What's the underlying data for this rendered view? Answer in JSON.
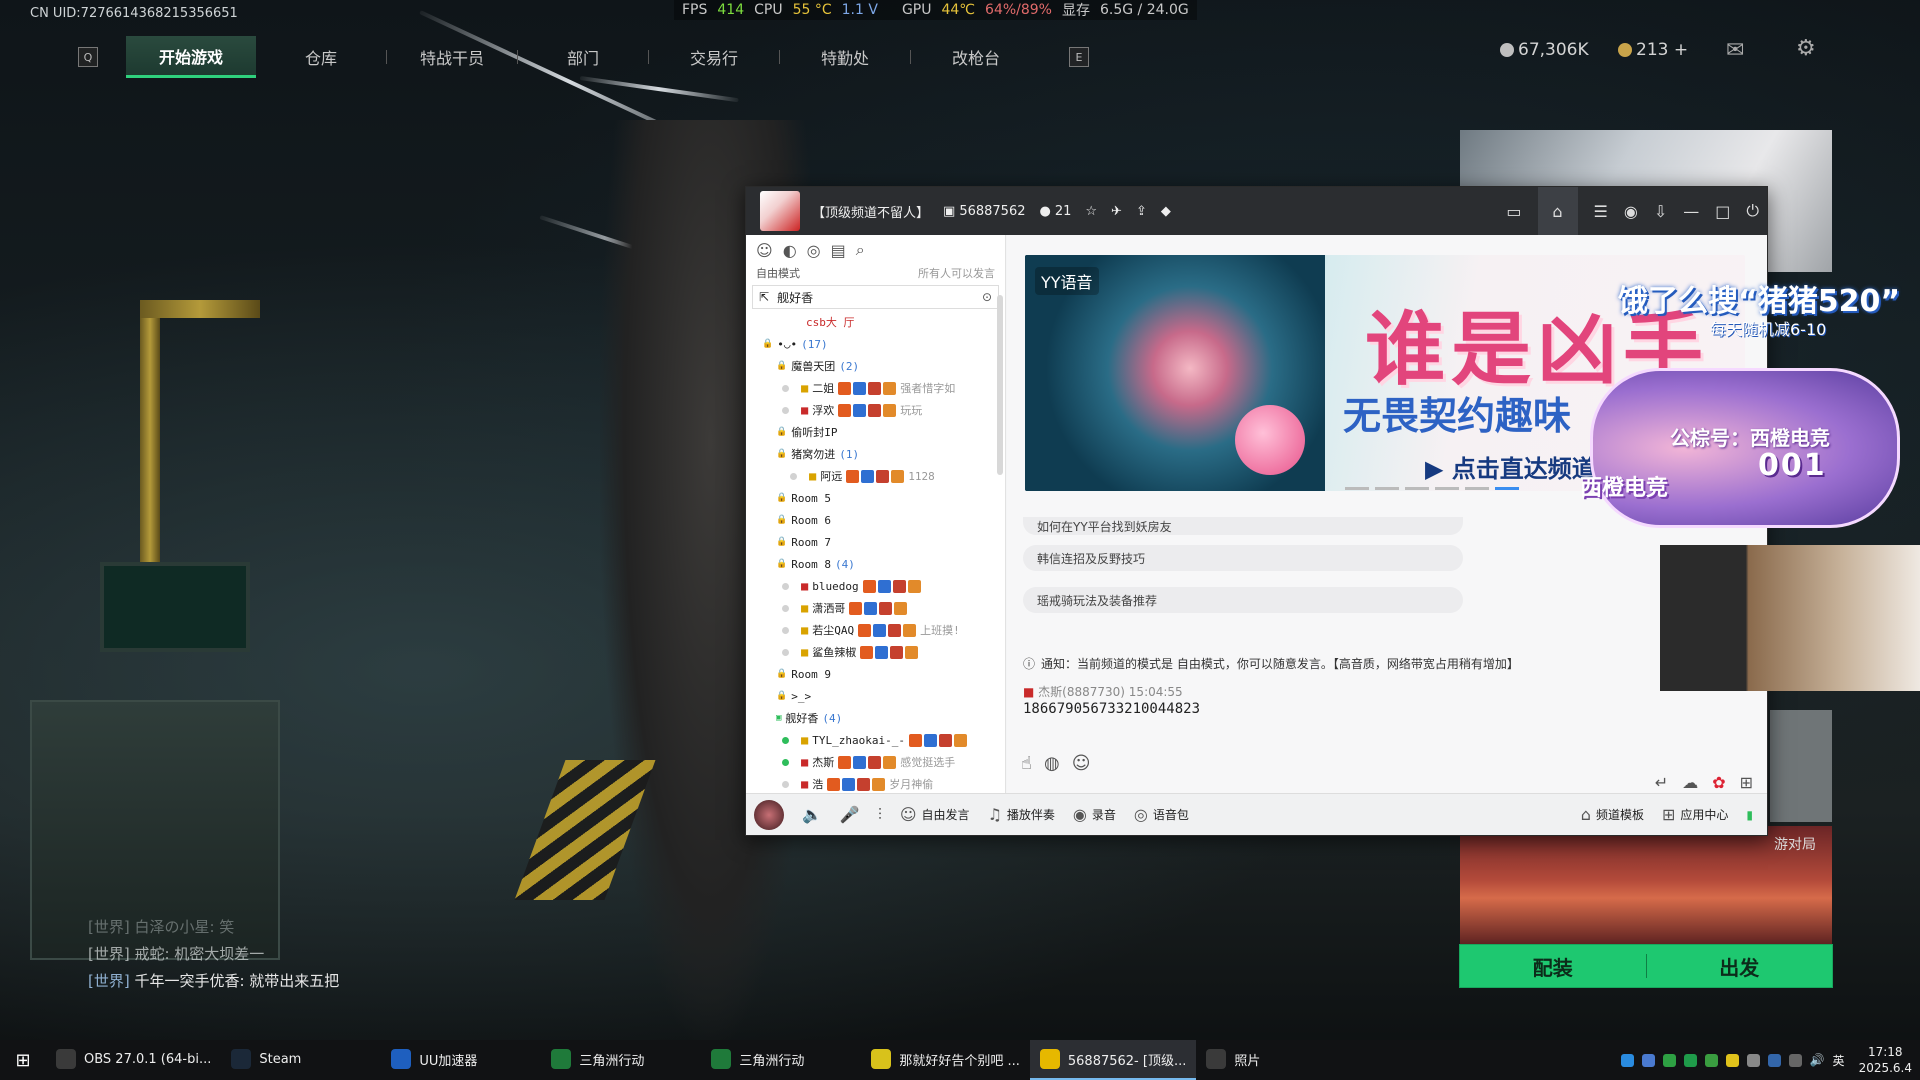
{
  "uid": "CN UID:7276614368215356651",
  "perf": {
    "fps_label": "FPS",
    "fps": "414",
    "cpu_label": "CPU",
    "cpu_temp": "55 °C",
    "cpu_volt": "1.1 V",
    "gpu_label": "GPU",
    "gpu_temp": "44℃",
    "gpu_load": "64%/89%",
    "vram_label": "显存",
    "vram": "6.5G / 24.0G"
  },
  "nav": {
    "key_left": "Q",
    "key_right": "E",
    "tabs": [
      {
        "label": "开始游戏"
      },
      {
        "label": "仓库"
      },
      {
        "label": "特战干员"
      },
      {
        "label": "部门"
      },
      {
        "label": "交易行"
      },
      {
        "label": "特勤处"
      },
      {
        "label": "改枪台"
      }
    ],
    "currency1": "67,306K",
    "currency2": "213 +"
  },
  "yy": {
    "channel_title": "【顶级频道不留人】",
    "channel_id": "56887562",
    "online_count": "21",
    "mode_label": "自由模式",
    "mode_right": "所有人可以发言",
    "channel_head": "舰好香",
    "tree": [
      {
        "indent": 60,
        "kind": "text",
        "text": "csb大 厅",
        "color": "#c92a2a"
      },
      {
        "indent": 16,
        "kind": "room",
        "text": "•◡•",
        "count": "(17)"
      },
      {
        "indent": 30,
        "kind": "room",
        "text": "魔兽天团",
        "count": "(2)"
      },
      {
        "indent": 36,
        "kind": "user",
        "icon": "gold",
        "text": "二姐",
        "note": "强者惜字如"
      },
      {
        "indent": 36,
        "kind": "user",
        "icon": "gift",
        "text": "浮欢",
        "note": "玩玩"
      },
      {
        "indent": 30,
        "kind": "room",
        "text": "偷听封IP",
        "count": ""
      },
      {
        "indent": 30,
        "kind": "room",
        "text": "猪窝勿进",
        "count": "(1)"
      },
      {
        "indent": 44,
        "kind": "user2",
        "icon": "gold",
        "text": "阿远",
        "note": "1128"
      },
      {
        "indent": 30,
        "kind": "room",
        "text": "Room 5",
        "count": ""
      },
      {
        "indent": 30,
        "kind": "room",
        "text": "Room 6",
        "count": ""
      },
      {
        "indent": 30,
        "kind": "room",
        "text": "Room 7",
        "count": ""
      },
      {
        "indent": 30,
        "kind": "room",
        "text": "Room 8",
        "count": "(4)"
      },
      {
        "indent": 36,
        "kind": "user",
        "icon": "gift",
        "text": "bluedog",
        "note": ""
      },
      {
        "indent": 36,
        "kind": "user",
        "icon": "gold",
        "text": "潇洒哥",
        "note": ""
      },
      {
        "indent": 36,
        "kind": "user",
        "icon": "gold",
        "text": "若尘QAQ",
        "note": "上班摸!"
      },
      {
        "indent": 36,
        "kind": "user",
        "icon": "gold",
        "text": "鲨鱼辣椒",
        "note": ""
      },
      {
        "indent": 30,
        "kind": "room",
        "text": "Room 9",
        "count": ""
      },
      {
        "indent": 30,
        "kind": "room",
        "text": ">_>",
        "count": ""
      },
      {
        "indent": 30,
        "kind": "room-green",
        "text": "舰好香",
        "count": "(4)"
      },
      {
        "indent": 36,
        "kind": "user-on",
        "icon": "gold",
        "text": "TYL_zhaokai-_-",
        "note": ""
      },
      {
        "indent": 36,
        "kind": "user-on",
        "icon": "gift",
        "text": "杰斯",
        "note": "感觉挺选手"
      },
      {
        "indent": 36,
        "kind": "user",
        "icon": "gift",
        "text": "浩",
        "note": "岁月神偷"
      }
    ],
    "banner": {
      "brand": "YY语音",
      "headline": "谁是凶手",
      "sub": "无畏契约趣味",
      "cta": "点击直达频道"
    },
    "questions": [
      "如何在YY平台找到妖房友",
      "韩信连招及反野技巧",
      "瑶戒骑玩法及装备推荐"
    ],
    "notice": "通知：当前频道的模式是 自由模式，你可以随意发言。【高音质，网络带宽占用稍有增加】",
    "msg_meta": "杰斯(8887730)  15:04:55",
    "msg_body": "1866790567332100448​23",
    "bottom": {
      "free_speak": "自由发言",
      "play_music": "播放伴奏",
      "record": "录音",
      "voice_pack": "语音包",
      "template": "频道模板",
      "app_center": "应用中心"
    }
  },
  "overlay": {
    "promo_line1": "饿了么搜“猪猪520”",
    "promo_line2": "每天随机减6-10",
    "sticker_line1": "公棕号：西橙电竞",
    "sticker_line2": "001",
    "sticker_brand": "西橙电竞",
    "thumb_label": "游对局",
    "deploy_left": "配装",
    "deploy_right": "出发"
  },
  "chat": [
    {
      "ch": "[世界]",
      "text": " 白泽の小星: 笑"
    },
    {
      "ch": "[世界]",
      "text": " 戒蛇: 机密大坝差一"
    },
    {
      "ch": "[世界]",
      "text": " 千年一突手优香: 就带出来五把"
    }
  ],
  "taskbar": {
    "items": [
      {
        "label": "OBS 27.0.1 (64-bi...",
        "color": "#3a3a3a",
        "active": false
      },
      {
        "label": "Steam",
        "color": "#1b2838",
        "active": false
      },
      {
        "label": "UU加速器",
        "color": "#1e5fbf",
        "active": false
      },
      {
        "label": "三角洲行动",
        "color": "#1f7a3a",
        "active": false
      },
      {
        "label": "三角洲行动",
        "color": "#1f7a3a",
        "active": false
      },
      {
        "label": "那就好好告个别吧 ...",
        "color": "#d8c21b",
        "active": false
      },
      {
        "label": "56887562- [顶级...",
        "color": "#e6b800",
        "active": true
      },
      {
        "label": "照片",
        "color": "#3a3a3a",
        "active": false
      }
    ],
    "ime": "英",
    "time": "17:18",
    "date": "2025.6.4"
  }
}
